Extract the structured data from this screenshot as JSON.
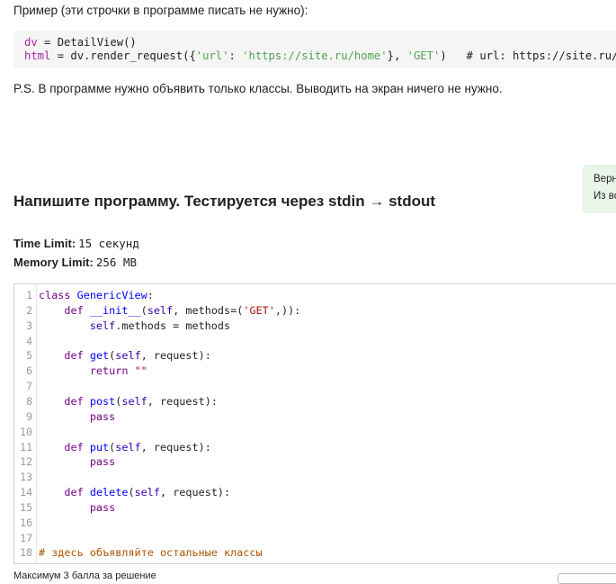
{
  "intro_text": "Пример (эти строчки в программе писать не нужно):",
  "example": {
    "line1": "dv = DetailView()",
    "line2": "html = dv.render_request({'url': 'https://site.ru/home'}, 'GET')   # url: https://site.ru/home"
  },
  "ps_text": "P.S. В программе нужно объявить только классы. Выводить на экран ничего не нужно.",
  "side_panel": {
    "line1": "Верн",
    "line2": "Из вс"
  },
  "task_title": "Напишите программу. Тестируется через stdin → stdout",
  "limits": {
    "time_label": "Time Limit:",
    "time_value": "15 секунд",
    "memory_label": "Memory Limit:",
    "memory_value": "256 MB"
  },
  "code_lines": [
    "class GenericView:",
    "    def __init__(self, methods=('GET',)):",
    "        self.methods = methods",
    "",
    "    def get(self, request):",
    "        return \"\"",
    "",
    "    def post(self, request):",
    "        pass",
    "",
    "    def put(self, request):",
    "        pass",
    "",
    "    def delete(self, request):",
    "        pass",
    "",
    "",
    "# здесь объявляйте остальные классы"
  ],
  "footer_text": "Максимум 3 балла за решение"
}
